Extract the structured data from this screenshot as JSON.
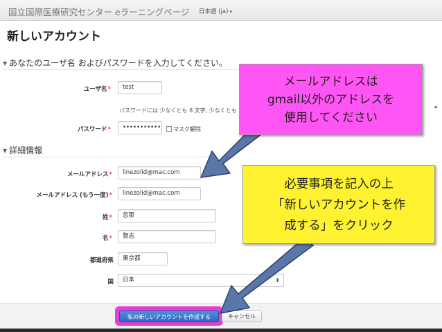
{
  "navbar": {
    "brand": "国立国際医療研究センター eラーニングページ",
    "language": "日本語 (ja)"
  },
  "page_title": "新しいアカウント",
  "section_account": {
    "legend": "あなたのユーザ名 およびパスワードを入力してください。",
    "username_label": "ユーザ名",
    "username_value": "test",
    "password_hint": "パスワードには 少なくとも 8 文字, 少なくとも",
    "password_label": "パスワード",
    "password_value": "•••••••••••",
    "unmask_label": "マスク解除"
  },
  "section_details": {
    "legend": "詳細情報",
    "email_label": "メールアドレス",
    "email_value": "linezolid@mac.com",
    "email2_label": "メールアドレス (もう一度)",
    "email2_value": "linezolid@mac.com",
    "lastname_label": "姓",
    "lastname_value": "忽那",
    "firstname_label": "名",
    "firstname_value": "賢志",
    "city_label": "都道府県",
    "city_value": "東京都",
    "country_label": "国",
    "country_value": "日本"
  },
  "buttons": {
    "submit": "私の新しいアカウントを作成する",
    "cancel": "キャンセル"
  },
  "callouts": {
    "pink": [
      "メールアドレスは",
      "gmail以外のアドレスを",
      "使用してください"
    ],
    "yellow": [
      "必要事項を記入の上",
      "「新しいアカウントを作",
      "成する」をクリック"
    ]
  },
  "required_mark": "*",
  "colors": {
    "pink_callout": "#ff55f5",
    "yellow_callout": "#fff231",
    "arrow": "#5a77aa",
    "submit_highlight": "#e43fd6",
    "submit_button": "#2d67bf"
  }
}
